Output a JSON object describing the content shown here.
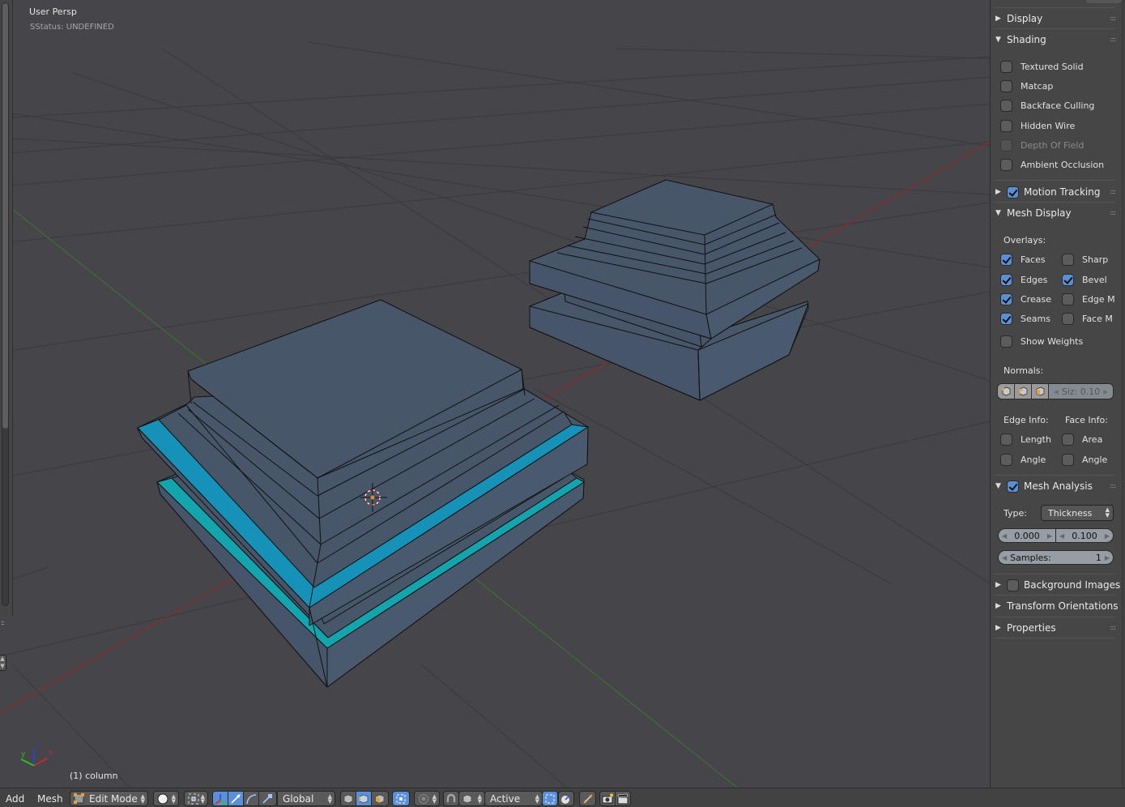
{
  "viewport": {
    "view_name": "User Persp",
    "status": "SStatus: UNDEFINED",
    "object_label": "(1) column",
    "axes": {
      "x": "x",
      "y": "y",
      "z": "z"
    },
    "colors": {
      "background": "#464549",
      "grid": "#3b3b3e",
      "x_axis": "#8e2b2b",
      "y_axis": "#3b6f34",
      "mesh_face": "#475669",
      "analysis_blue": "#1692b8",
      "analysis_cyan": "#13a4ad"
    }
  },
  "properties_panel": {
    "display": {
      "label": "Display",
      "expanded": false
    },
    "shading": {
      "label": "Shading",
      "expanded": true,
      "options": [
        {
          "label": "Textured Solid",
          "checked": false,
          "enabled": true
        },
        {
          "label": "Matcap",
          "checked": false,
          "enabled": true
        },
        {
          "label": "Backface Culling",
          "checked": false,
          "enabled": true
        },
        {
          "label": "Hidden Wire",
          "checked": false,
          "enabled": true
        },
        {
          "label": "Depth Of Field",
          "checked": false,
          "enabled": false
        },
        {
          "label": "Ambient Occlusion",
          "checked": false,
          "enabled": true
        }
      ]
    },
    "motion_tracking": {
      "label": "Motion Tracking",
      "expanded": false,
      "checked": true
    },
    "mesh_display": {
      "label": "Mesh Display",
      "expanded": true,
      "overlays_label": "Overlays:",
      "overlays_left": [
        {
          "label": "Faces",
          "checked": true
        },
        {
          "label": "Edges",
          "checked": true
        },
        {
          "label": "Crease",
          "checked": true
        },
        {
          "label": "Seams",
          "checked": true
        }
      ],
      "overlays_right": [
        {
          "label": "Sharp",
          "checked": false
        },
        {
          "label": "Bevel",
          "checked": true
        },
        {
          "label": "Edge M",
          "checked": false
        },
        {
          "label": "Face M",
          "checked": false
        }
      ],
      "show_weights": {
        "label": "Show Weights",
        "checked": false
      },
      "normals_label": "Normals:",
      "normals_size": "Siz: 0.10",
      "edge_info_label": "Edge Info:",
      "face_info_label": "Face Info:",
      "edge_info": [
        {
          "label": "Length",
          "checked": false
        },
        {
          "label": "Angle",
          "checked": false
        }
      ],
      "face_info": [
        {
          "label": "Area",
          "checked": false
        },
        {
          "label": "Angle",
          "checked": false
        }
      ]
    },
    "mesh_analysis": {
      "label": "Mesh Analysis",
      "expanded": true,
      "checked": true,
      "type_label": "Type:",
      "type_value": "Thickness",
      "min": "0.000",
      "max": "0.100",
      "samples_label": "Samples:",
      "samples_value": "1"
    },
    "background_images": {
      "label": "Background Images",
      "expanded": false,
      "checked": false
    },
    "transform_orientations": {
      "label": "Transform Orientations",
      "expanded": false
    },
    "properties": {
      "label": "Properties",
      "expanded": false
    }
  },
  "header": {
    "menu_add": "Add",
    "menu_mesh": "Mesh",
    "mode": "Edit Mode",
    "orientation": "Global",
    "pivot_snap_target": "Active"
  }
}
